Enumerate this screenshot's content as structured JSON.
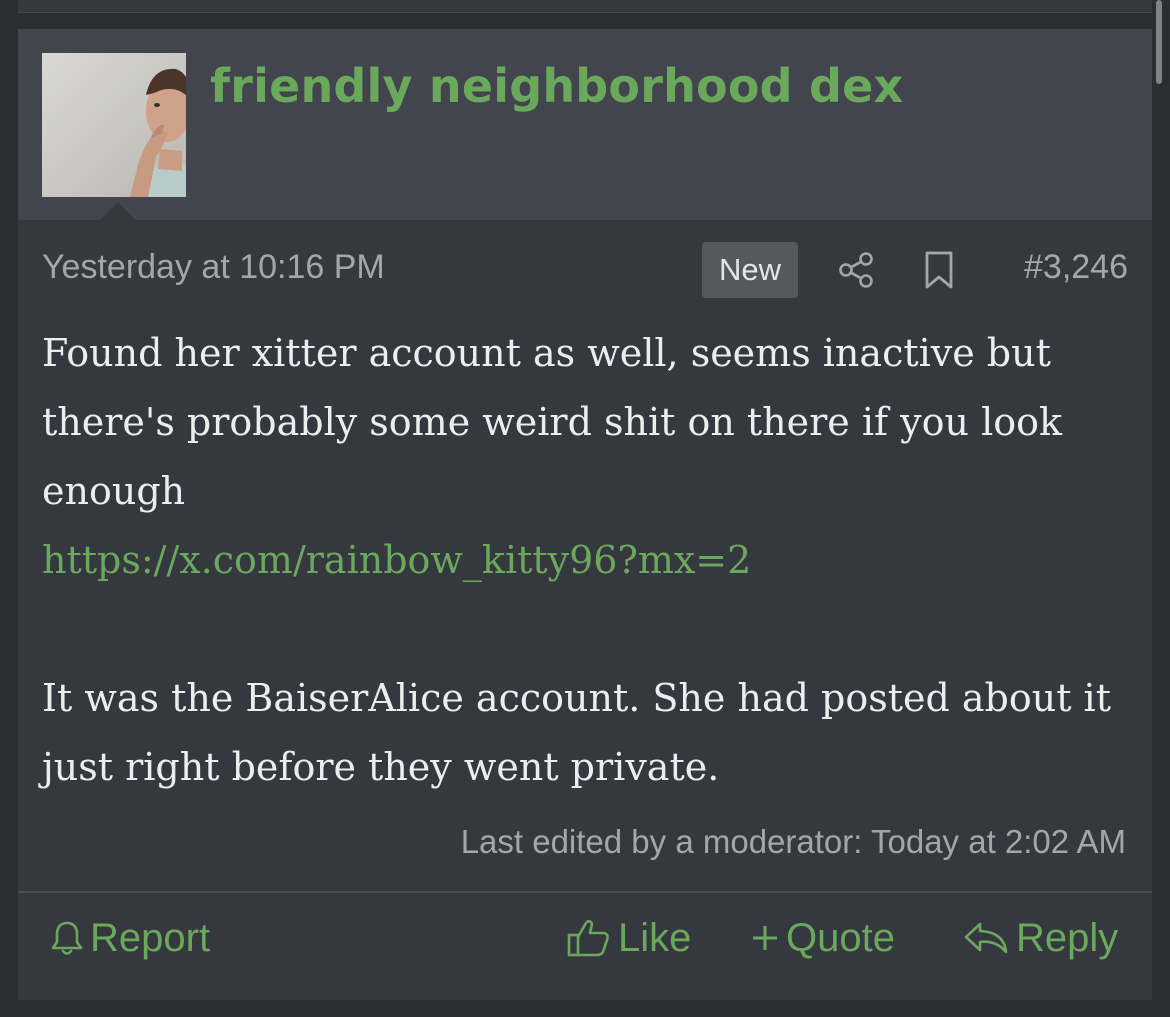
{
  "post": {
    "author": "friendly neighborhood dex",
    "timestamp": "Yesterday at 10:16 PM",
    "badge": "New",
    "post_number": "#3,246",
    "body": {
      "line1": "Found her xitter account as well, seems inactive but there's probably some weird shit on there if you look enough",
      "link": "https://x.com/rainbow_kitty96?mx=2",
      "line2": "It was the BaiserAlice account. She had posted about it just right before they went private."
    },
    "edited_note": "Last edited by a moderator: Today at 2:02 AM",
    "actions": {
      "report": "Report",
      "like": "Like",
      "quote": "Quote",
      "reply": "Reply"
    }
  },
  "icons": {
    "share": "share-icon",
    "bookmark": "bookmark-icon",
    "report": "bell-icon",
    "like": "thumbs-up-icon",
    "quote": "plus-icon",
    "reply": "reply-arrow-icon"
  },
  "colors": {
    "accent": "#6aa85c",
    "background": "#2b2d33",
    "card": "#363840",
    "header": "#42454d",
    "text": "#eceded",
    "muted": "#a4a6ab"
  }
}
